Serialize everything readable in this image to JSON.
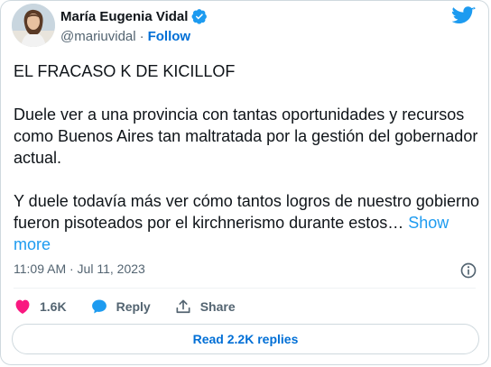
{
  "author": {
    "name": "María Eugenia Vidal",
    "handle": "@mariuvidal",
    "separator": "·",
    "follow_label": "Follow"
  },
  "tweet": {
    "paragraphs": [
      "EL FRACASO K DE KICILLOF",
      "Duele ver a una provincia con tantas oportunidades y recursos como Buenos Aires tan maltratada por la gestión del gobernador actual.",
      "Y duele todavía más ver cómo tantos logros de nuestro gobierno fueron pisoteados por el kirchnerismo durante estos…"
    ],
    "show_more_label": "Show more",
    "timestamp": "11:09 AM · Jul 11, 2023"
  },
  "actions": {
    "likes": "1.6K",
    "reply_label": "Reply",
    "share_label": "Share"
  },
  "read_replies_label": "Read 2.2K replies",
  "icons": {
    "verified": "verified-badge-icon",
    "logo": "twitter-bird-icon",
    "info": "info-icon",
    "like": "heart-icon",
    "reply": "speech-bubble-icon",
    "share": "share-icon"
  },
  "colors": {
    "accent": "#1d9bf0",
    "link": "#006fd6",
    "like": "#f91880",
    "muted": "#536471",
    "text": "#0f1419",
    "border": "#cfd9de"
  }
}
